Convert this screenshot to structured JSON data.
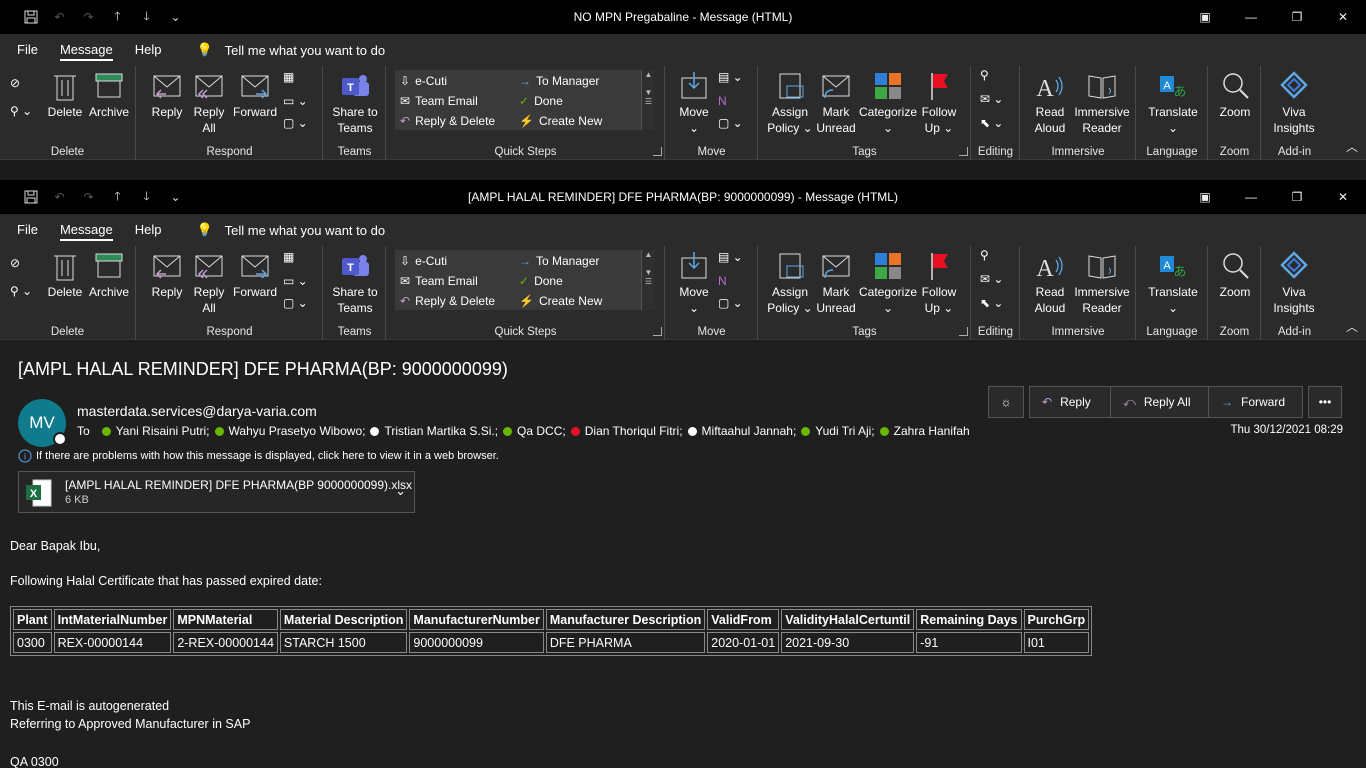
{
  "window1": {
    "title": "NO MPN Pregabaline  -  Message (HTML)"
  },
  "window2": {
    "title": "[AMPL HALAL REMINDER] DFE PHARMA(BP: 9000000099)  -  Message (HTML)"
  },
  "tabs": [
    "File",
    "Message",
    "Help"
  ],
  "tell_me": "Tell me what you want to do",
  "ribbon": {
    "delete": {
      "delete": "Delete",
      "archive": "Archive",
      "group": "Delete"
    },
    "respond": {
      "reply": "Reply",
      "reply_all_1": "Reply",
      "reply_all_2": "All",
      "forward": "Forward",
      "group": "Respond"
    },
    "teams": {
      "share_1": "Share to",
      "share_2": "Teams",
      "group": "Teams"
    },
    "quick_steps": {
      "items": [
        "e-Cuti",
        "Team Email",
        "Reply & Delete",
        "To Manager",
        "Done",
        "Create New"
      ],
      "group": "Quick Steps"
    },
    "move": {
      "move": "Move",
      "group": "Move"
    },
    "tags": {
      "assign_1": "Assign",
      "assign_2": "Policy",
      "mark_1": "Mark",
      "mark_2": "Unread",
      "categorize": "Categorize",
      "follow_1": "Follow",
      "follow_2": "Up",
      "group": "Tags"
    },
    "editing": {
      "group": "Editing"
    },
    "immersive": {
      "read_1": "Read",
      "read_2": "Aloud",
      "imm_1": "Immersive",
      "imm_2": "Reader",
      "group": "Immersive"
    },
    "language": {
      "translate": "Translate",
      "group": "Language"
    },
    "zoom": {
      "zoom": "Zoom",
      "group": "Zoom"
    },
    "addin": {
      "viva_1": "Viva",
      "viva_2": "Insights",
      "group": "Add-in"
    }
  },
  "message": {
    "subject": "[AMPL HALAL REMINDER] DFE PHARMA(BP: 9000000099)",
    "avatar_initials": "MV",
    "from": "masterdata.services@darya-varia.com",
    "to_label": "To",
    "recipients": [
      {
        "name": "Yani Risaini Putri;",
        "status": "green"
      },
      {
        "name": "Wahyu Prasetyo Wibowo;",
        "status": "green"
      },
      {
        "name": "Tristian Martika S.Si.;",
        "status": "white"
      },
      {
        "name": "Qa DCC;",
        "status": "green"
      },
      {
        "name": "Dian Thoriqul Fitri;",
        "status": "red"
      },
      {
        "name": "Miftaahul Jannah;",
        "status": "white"
      },
      {
        "name": "Yudi Tri Aji;",
        "status": "green"
      },
      {
        "name": "Zahra Hanifah",
        "status": "green"
      }
    ],
    "date": "Thu 30/12/2021 08:29",
    "info": "If there are problems with how this message is displayed, click here to view it in a web browser.",
    "attachment": {
      "name": "[AMPL HALAL REMINDER] DFE PHARMA(BP 9000000099).xlsx",
      "size": "6 KB"
    },
    "actions": {
      "reply": "Reply",
      "reply_all": "Reply All",
      "forward": "Forward"
    },
    "greeting": "Dear Bapak Ibu,",
    "intro": "Following Halal Certificate that has passed expired date:",
    "table": {
      "headers": [
        "Plant",
        "IntMaterialNumber",
        "MPNMaterial",
        "Material Description",
        "ManufacturerNumber",
        "Manufacturer Description",
        "ValidFrom",
        "ValidityHalalCertuntil",
        "Remaining Days",
        "PurchGrp"
      ],
      "rows": [
        [
          "0300",
          "REX-00000144",
          "2-REX-00000144",
          "STARCH 1500",
          "9000000099",
          "DFE PHARMA",
          "2020-01-01",
          "2021-09-30",
          "-91",
          "I01"
        ]
      ]
    },
    "footer1": "This E-mail is autogenerated",
    "footer2": "Referring to Approved Manufacturer in SAP",
    "footer3": "QA 0300"
  }
}
